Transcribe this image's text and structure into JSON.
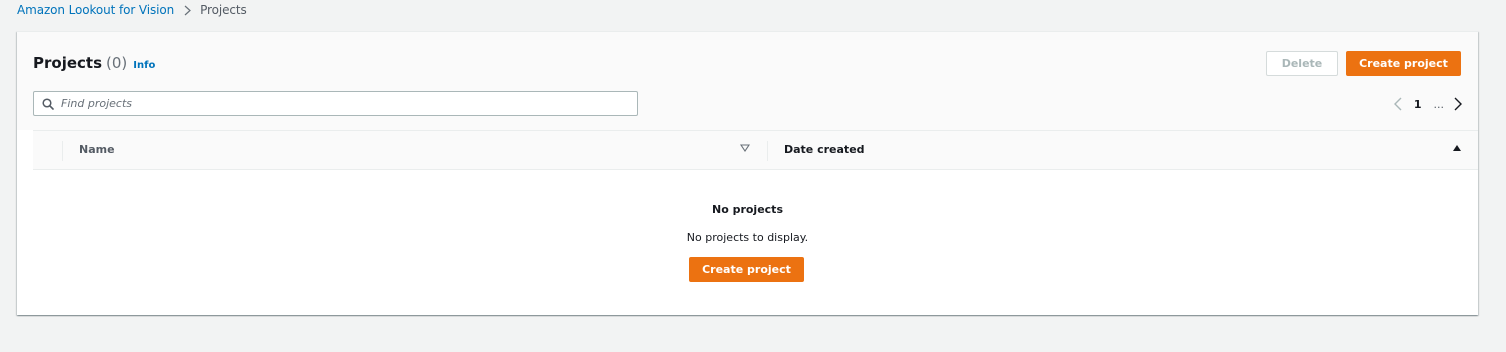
{
  "breadcrumb": {
    "service": "Amazon Lookout for Vision",
    "current": "Projects"
  },
  "header": {
    "title": "Projects",
    "count": "(0)",
    "info": "Info",
    "delete_label": "Delete",
    "create_label": "Create project"
  },
  "search": {
    "placeholder": "Find projects",
    "value": ""
  },
  "pagination": {
    "page": "1",
    "ellipsis": "..."
  },
  "table": {
    "columns": [
      "Name",
      "Date created"
    ]
  },
  "empty_state": {
    "title": "No projects",
    "description": "No projects to display.",
    "button_label": "Create project"
  },
  "colors": {
    "accent": "#ec7211",
    "link": "#0073bb",
    "background": "#f2f3f3"
  },
  "icons": {
    "breadcrumb_separator": "chevron-right-icon",
    "search": "search-icon",
    "prev": "chevron-left-icon",
    "next": "chevron-right-icon",
    "sort_name": "caret-down-outline-icon",
    "sort_date": "caret-up-filled-icon"
  }
}
